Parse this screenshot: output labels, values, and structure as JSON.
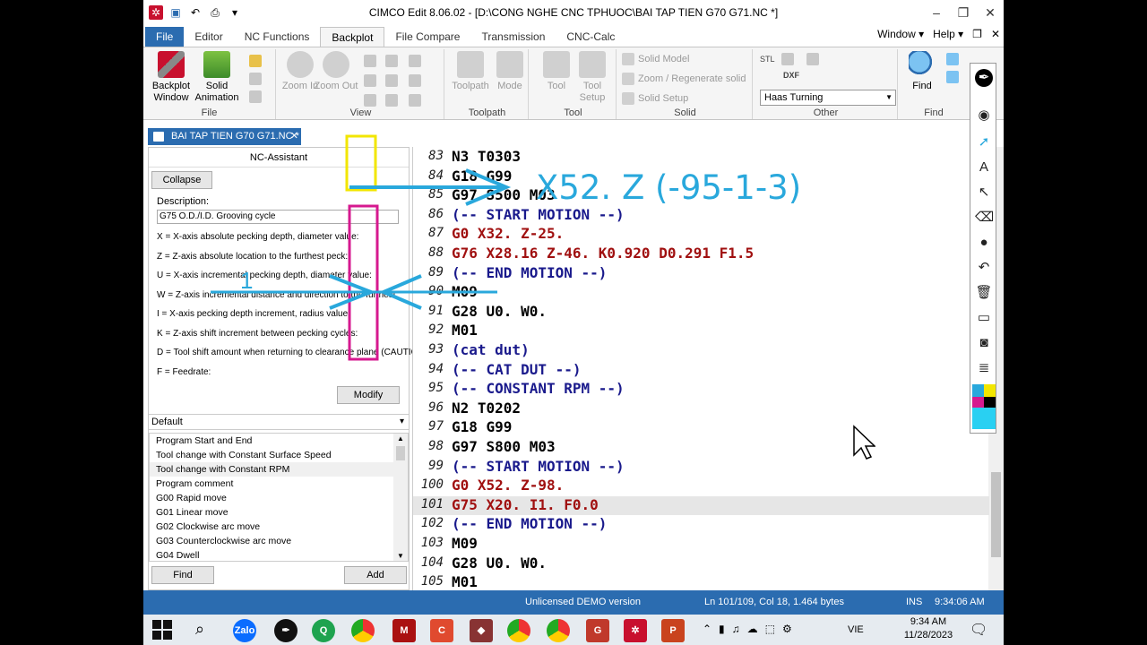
{
  "window": {
    "title": "CIMCO Edit 8.06.02 - [D:\\CONG NGHE CNC TPHUOC\\BAI TAP TIEN G70 G71.NC *]",
    "controls": [
      "–",
      "❐",
      "✕"
    ]
  },
  "ribbon_tabs": [
    "File",
    "Editor",
    "NC Functions",
    "Backplot",
    "File Compare",
    "Transmission",
    "CNC-Calc"
  ],
  "active_tab": "Backplot",
  "tab_right": {
    "window": "Window ▾",
    "help": "Help ▾"
  },
  "ribbon": {
    "file_group": {
      "label": "File",
      "backplot_window": "Backplot Window",
      "solid_animation": "Solid Animation"
    },
    "view_group": {
      "label": "View",
      "zoom_in": "Zoom In",
      "zoom_out": "Zoom Out"
    },
    "toolpath_group": {
      "label": "Toolpath",
      "toolpath": "Toolpath",
      "mode": "Mode"
    },
    "tool_group": {
      "label": "Tool",
      "tool": "Tool",
      "tool_setup": "Tool Setup"
    },
    "solid_group": {
      "label": "Solid",
      "solid_model": "Solid Model",
      "zoom_regen": "Zoom / Regenerate solid",
      "solid_setup": "Solid Setup"
    },
    "other_group": {
      "label": "Other",
      "machine": "Haas Turning",
      "stl": "STL",
      "dxf": "DXF"
    },
    "find_group": {
      "label": "Find",
      "find": "Find"
    }
  },
  "doc_tab": {
    "label": "BAI TAP TIEN G70 G71.NC *"
  },
  "nc_assistant": {
    "title": "NC-Assistant",
    "collapse": "Collapse",
    "description_label": "Description:",
    "description_value": "G75 O.D./I.D. Grooving cycle",
    "params": [
      "X = X-axis absolute pecking depth, diameter value:",
      "Z = Z-axis absolute location to the furthest peck:",
      "U = X-axis incremental pecking depth, diameter value:",
      "W = Z-axis incremental distance and direction to the furthest:",
      "I = X-axis pecking depth increment, radius value:",
      "K = Z-axis shift increment between pecking cycles:",
      "D = Tool shift amount when returning to clearance plane (CAUTION",
      "F = Feedrate:"
    ],
    "modify": "Modify",
    "select": "Default",
    "list": [
      "Program Start and End",
      "Tool change with Constant Surface Speed",
      "Tool change with Constant RPM",
      "Program comment",
      "G00 Rapid move",
      "G01 Linear move",
      "G02 Clockwise arc move",
      "G03 Counterclockwise arc move",
      "G04 Dwell"
    ],
    "find": "Find",
    "add": "Add"
  },
  "editor": {
    "lines": [
      {
        "n": "83",
        "code": "N3 T0303",
        "color": "#000000"
      },
      {
        "n": "84",
        "code": "G18 G99",
        "color": "#000000"
      },
      {
        "n": "85",
        "code": "G97 S500 M03",
        "color": "#000000"
      },
      {
        "n": "86",
        "code": "(-- START MOTION --)",
        "color": "#1a1a8c"
      },
      {
        "n": "87",
        "code": "G0 X32. Z-25.",
        "color": "#a01010"
      },
      {
        "n": "88",
        "code": "G76 X28.16 Z-46. K0.920 D0.291 F1.5",
        "color": "#a01010"
      },
      {
        "n": "89",
        "code": "(-- END MOTION --)",
        "color": "#1a1a8c"
      },
      {
        "n": "90",
        "code": "M09",
        "color": "#000000"
      },
      {
        "n": "91",
        "code": "G28 U0. W0.",
        "color": "#000000"
      },
      {
        "n": "92",
        "code": "M01",
        "color": "#000000"
      },
      {
        "n": "93",
        "code": "(cat dut)",
        "color": "#1a1a8c"
      },
      {
        "n": "94",
        "code": "(-- CAT DUT --)",
        "color": "#1a1a8c"
      },
      {
        "n": "95",
        "code": "(-- CONSTANT RPM --)",
        "color": "#1a1a8c"
      },
      {
        "n": "96",
        "code": "N2 T0202",
        "color": "#000000"
      },
      {
        "n": "97",
        "code": "G18 G99",
        "color": "#000000"
      },
      {
        "n": "98",
        "code": "G97 S800 M03",
        "color": "#000000"
      },
      {
        "n": "99",
        "code": "(-- START MOTION --)",
        "color": "#1a1a8c"
      },
      {
        "n": "100",
        "code": "G0 X52. Z-98.",
        "color": "#a01010"
      },
      {
        "n": "101",
        "code": "G75 X20. I1. F0.0",
        "color": "#a01010"
      },
      {
        "n": "102",
        "code": "(-- END MOTION --)",
        "color": "#1a1a8c"
      },
      {
        "n": "103",
        "code": "M09",
        "color": "#000000"
      },
      {
        "n": "104",
        "code": "G28 U0. W0.",
        "color": "#000000"
      },
      {
        "n": "105",
        "code": "M01",
        "color": "#000000"
      }
    ],
    "current_line_index": 18
  },
  "status_bar": {
    "license": "Unlicensed DEMO version",
    "position": "Ln 101/109, Col 18, 1.464 bytes",
    "mode": "INS",
    "time": "9:34:06 AM"
  },
  "annotation": {
    "text": "X52. Z (-95-1-3)",
    "number": "1"
  },
  "taskbar": {
    "clock_time": "9:34 AM",
    "clock_date": "11/28/2023",
    "lang": "VIE",
    "apps": [
      "Zalo",
      "P"
    ]
  },
  "colors": {
    "accent": "#2b6cb0",
    "annotation": "#29a8dc",
    "highlight_yellow": "#f2e600",
    "highlight_magenta": "#d6198f"
  }
}
